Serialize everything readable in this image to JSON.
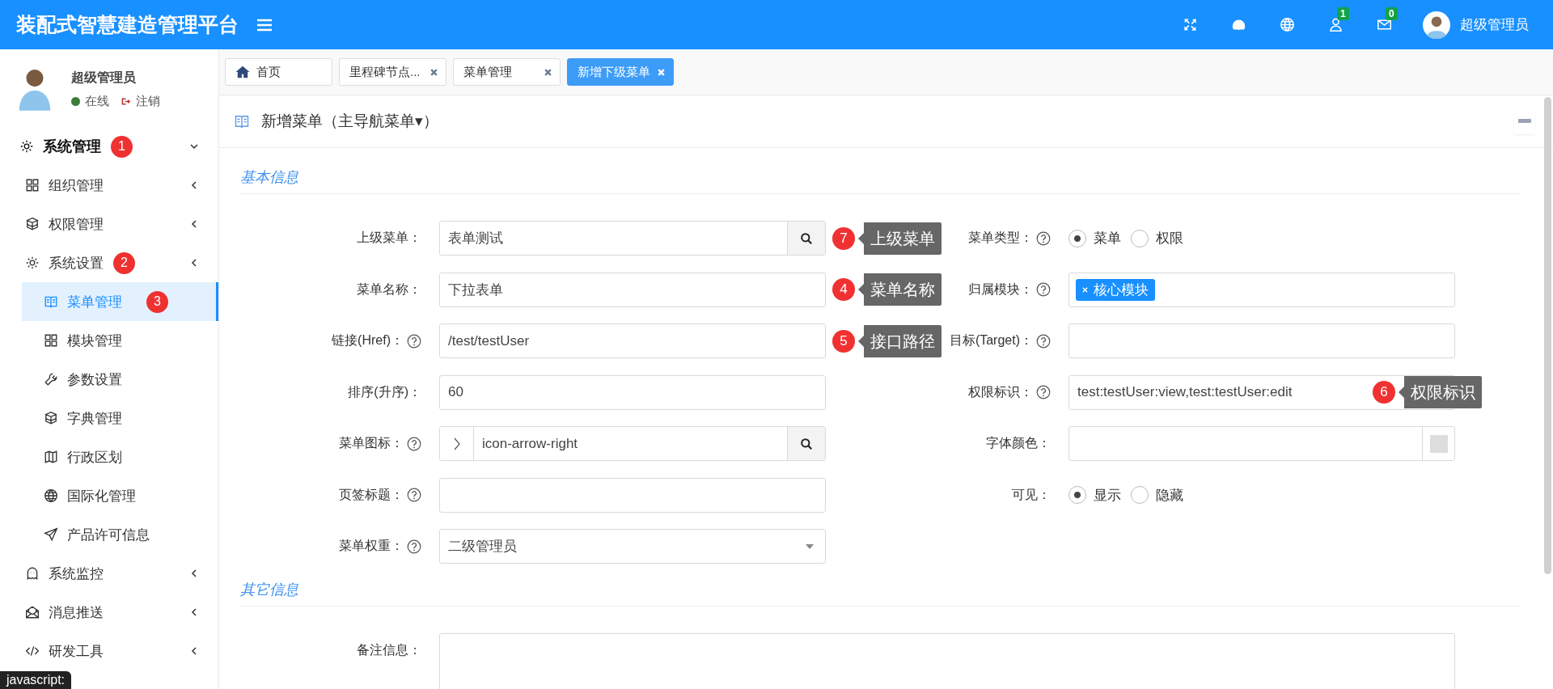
{
  "header": {
    "title": "装配式智慧建造管理平台",
    "tools": [
      {
        "kind": "fullscreen"
      },
      {
        "kind": "dashboard"
      },
      {
        "kind": "language"
      },
      {
        "kind": "contacts",
        "badge": "1"
      },
      {
        "kind": "messages",
        "badge": "0"
      }
    ],
    "user": "超级管理员"
  },
  "sidebar": {
    "profile": {
      "name": "超级管理员",
      "status": "在线",
      "logout": "注销"
    },
    "items": [
      {
        "label": "系统管理",
        "expanded": true,
        "badge": "1",
        "children": [
          {
            "label": "组织管理",
            "submenu": true
          },
          {
            "label": "权限管理",
            "submenu": true
          },
          {
            "label": "系统设置",
            "submenu": true,
            "badge": "2",
            "children": [
              {
                "label": "菜单管理",
                "selected": true,
                "badge": "3"
              },
              {
                "label": "模块管理",
                "selected": false
              },
              {
                "label": "参数设置",
                "selected": false
              },
              {
                "label": "字典管理",
                "selected": false
              },
              {
                "label": "行政区划",
                "selected": false
              },
              {
                "label": "国际化管理",
                "selected": false
              },
              {
                "label": "产品许可信息",
                "selected": false
              }
            ]
          },
          {
            "label": "系统监控",
            "submenu": true
          },
          {
            "label": "消息推送",
            "submenu": true
          },
          {
            "label": "研发工具",
            "submenu": true
          }
        ]
      }
    ]
  },
  "tabs": [
    {
      "label": "首页",
      "selected": false,
      "home": true,
      "closable": false
    },
    {
      "label": "里程碑节点...",
      "selected": false,
      "closable": true
    },
    {
      "label": "菜单管理",
      "selected": false,
      "closable": true
    },
    {
      "label": "新增下级菜单",
      "selected": true,
      "closable": true
    }
  ],
  "panel": {
    "title": "新增菜单（主导航菜单▾）",
    "sections": [
      {
        "title": "基本信息",
        "rows": [
          [
            {
              "label": "上级菜单：",
              "help": false,
              "kind": "search",
              "value": "表单测试",
              "callout": {
                "number": "7",
                "text": "上级菜单"
              }
            },
            {
              "label": "菜单类型：",
              "help": true,
              "kind": "radio",
              "options": [
                {
                  "label": "菜单",
                  "selected": true
                },
                {
                  "label": "权限",
                  "selected": false
                }
              ]
            }
          ],
          [
            {
              "label": "菜单名称：",
              "help": false,
              "kind": "text",
              "value": "下拉表单",
              "callout": {
                "number": "4",
                "text": "菜单名称"
              }
            },
            {
              "label": "归属模块：",
              "help": true,
              "kind": "tags",
              "tags": [
                "核心模块"
              ]
            }
          ],
          [
            {
              "label": "链接(Href)：",
              "help": true,
              "kind": "text",
              "value": "/test/testUser",
              "callout": {
                "number": "5",
                "text": "接口路径"
              }
            },
            {
              "label": "目标(Target)：",
              "help": true,
              "kind": "text"
            }
          ],
          [
            {
              "label": "排序(升序)：",
              "help": false,
              "kind": "text",
              "value": "60"
            },
            {
              "label": "权限标识：",
              "help": true,
              "kind": "text",
              "value": "test:testUser:view,test:testUser:edit",
              "callout": {
                "number": "6",
                "text": "权限标识"
              }
            }
          ],
          [
            {
              "label": "菜单图标：",
              "help": true,
              "kind": "icon-search",
              "value": "icon-arrow-right"
            },
            {
              "label": "字体颜色：",
              "help": false,
              "kind": "color"
            }
          ],
          [
            {
              "label": "页签标题：",
              "help": true,
              "kind": "text"
            },
            {
              "label": "可见：",
              "help": false,
              "kind": "radio",
              "options": [
                {
                  "label": "显示",
                  "selected": true
                },
                {
                  "label": "隐藏",
                  "selected": false
                }
              ]
            }
          ],
          [
            {
              "label": "菜单权重：",
              "help": true,
              "kind": "select",
              "value": "二级管理员"
            }
          ]
        ]
      },
      {
        "title": "其它信息",
        "rows": [
          [
            {
              "label": "备注信息：",
              "help": false,
              "kind": "textarea"
            }
          ]
        ]
      }
    ]
  },
  "status_tooltip": "javascript:"
}
